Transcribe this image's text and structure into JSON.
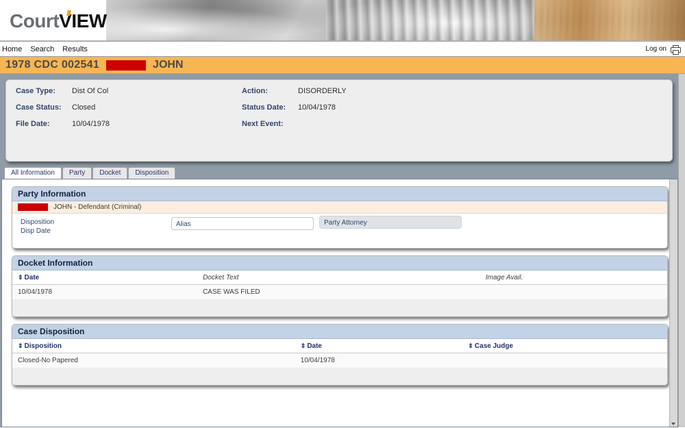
{
  "app": {
    "logo_court": "Court",
    "logo_view": "VIEW"
  },
  "nav": {
    "items": [
      {
        "label": "Home"
      },
      {
        "label": "Search"
      },
      {
        "label": "Results"
      }
    ],
    "logon_label": "Log on",
    "printer_icon": "printer-icon"
  },
  "case_title": {
    "case_number": "1978 CDC 002541",
    "redacted_name": "",
    "party_name": "JOHN"
  },
  "summary": {
    "left": [
      {
        "label": "Case Type:",
        "value": "Dist Of Col"
      },
      {
        "label": "Case Status:",
        "value": "Closed"
      },
      {
        "label": "File Date:",
        "value": "10/04/1978"
      }
    ],
    "right": [
      {
        "label": "Action:",
        "value": "DISORDERLY"
      },
      {
        "label": "Status Date:",
        "value": "10/04/1978"
      },
      {
        "label": "Next Event:",
        "value": ""
      }
    ]
  },
  "tabs": [
    {
      "label": "All Information",
      "active": true
    },
    {
      "label": "Party",
      "active": false
    },
    {
      "label": "Docket",
      "active": false
    },
    {
      "label": "Disposition",
      "active": false
    }
  ],
  "party_information": {
    "title": "Party Information",
    "party_row": {
      "redacted": "",
      "text": "JOHN - Defendant (Criminal)"
    },
    "disposition_label": "Disposition",
    "disp_date_label": "Disp Date",
    "alias_label": "Alias",
    "party_attorney_label": "Party Attorney"
  },
  "docket_information": {
    "title": "Docket Information",
    "columns": [
      {
        "label": "Date",
        "sortable": true
      },
      {
        "label": "Docket Text",
        "sortable": false
      },
      {
        "label": "Image Avail.",
        "sortable": false
      }
    ],
    "rows": [
      {
        "date": "10/04/1978",
        "docket_text": "CASE WAS FILED",
        "image_avail": ""
      }
    ]
  },
  "case_disposition": {
    "title": "Case Disposition",
    "columns": [
      {
        "label": "Disposition",
        "sortable": true
      },
      {
        "label": "Date",
        "sortable": true
      },
      {
        "label": "Case Judge",
        "sortable": true
      }
    ],
    "rows": [
      {
        "disposition": "Closed-No Papered",
        "date": "10/04/1978",
        "case_judge": ""
      }
    ]
  },
  "colors": {
    "title_bar": "#f7b553",
    "redaction": "#cc0000",
    "section_header": "#c3d2e5",
    "party_row": "#fbeee0",
    "page_background": "#8f9ba6",
    "label_blue": "#31456b"
  },
  "icons": {
    "sort": "⇕"
  }
}
